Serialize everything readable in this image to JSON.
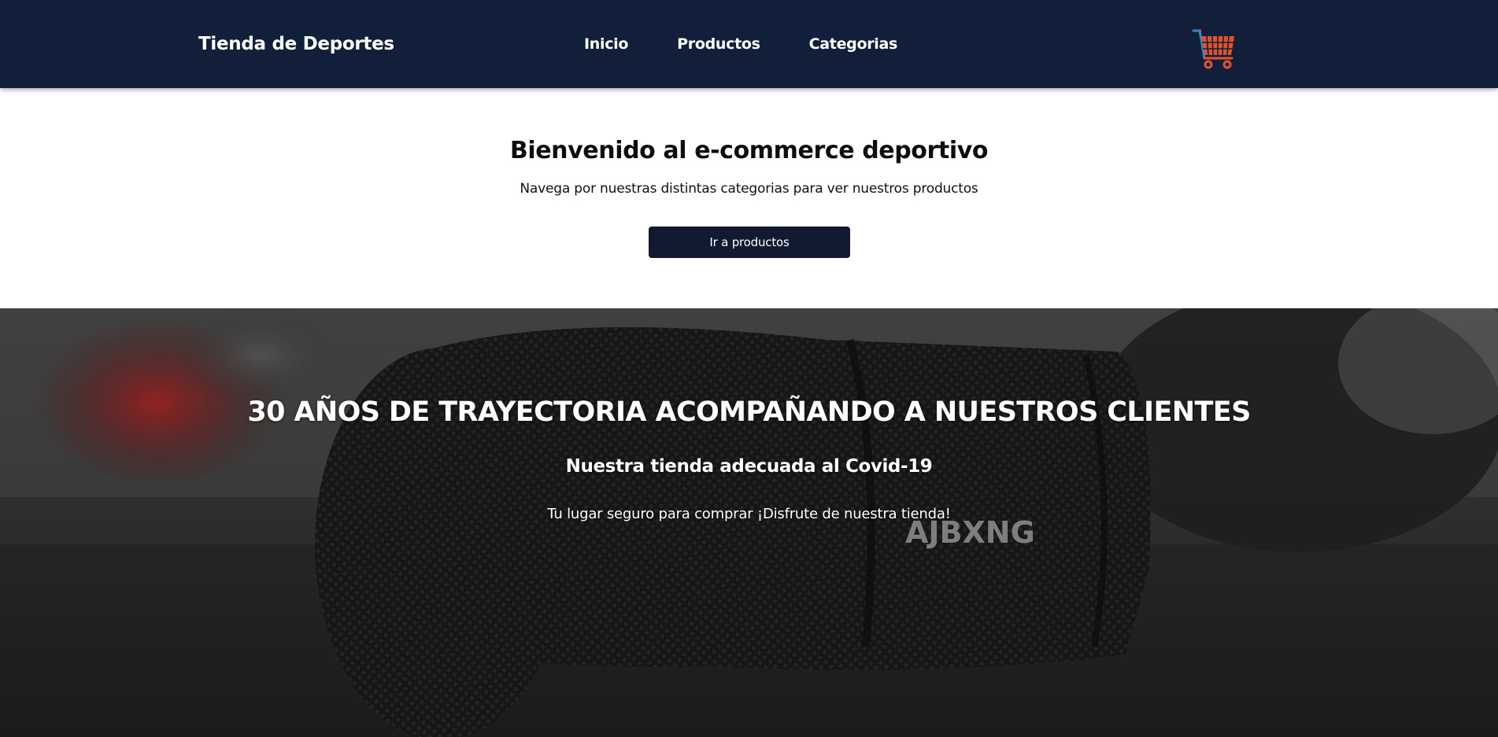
{
  "header": {
    "brand": "Tienda de Deportes",
    "nav": [
      {
        "label": "Inicio"
      },
      {
        "label": "Productos"
      },
      {
        "label": "Categorias"
      }
    ],
    "cart_icon": "shopping-cart-icon",
    "colors": {
      "background": "#111f3b",
      "cart": "#e2542c"
    }
  },
  "welcome": {
    "title": "Bienvenido al e-commerce deportivo",
    "subtitle": "Navega por nuestras distintas categorias para ver nuestros productos",
    "button_label": "Ir a productos"
  },
  "hero": {
    "title": "30 AÑOS DE TRAYECTORIA ACOMPAÑANDO A NUESTROS CLIENTES",
    "subtitle": "Nuestra tienda adecuada al Covid-19",
    "text": "Tu lugar seguro para comprar ¡Disfrute de nuestra tienda!",
    "glove_print": "AJBXNG"
  }
}
